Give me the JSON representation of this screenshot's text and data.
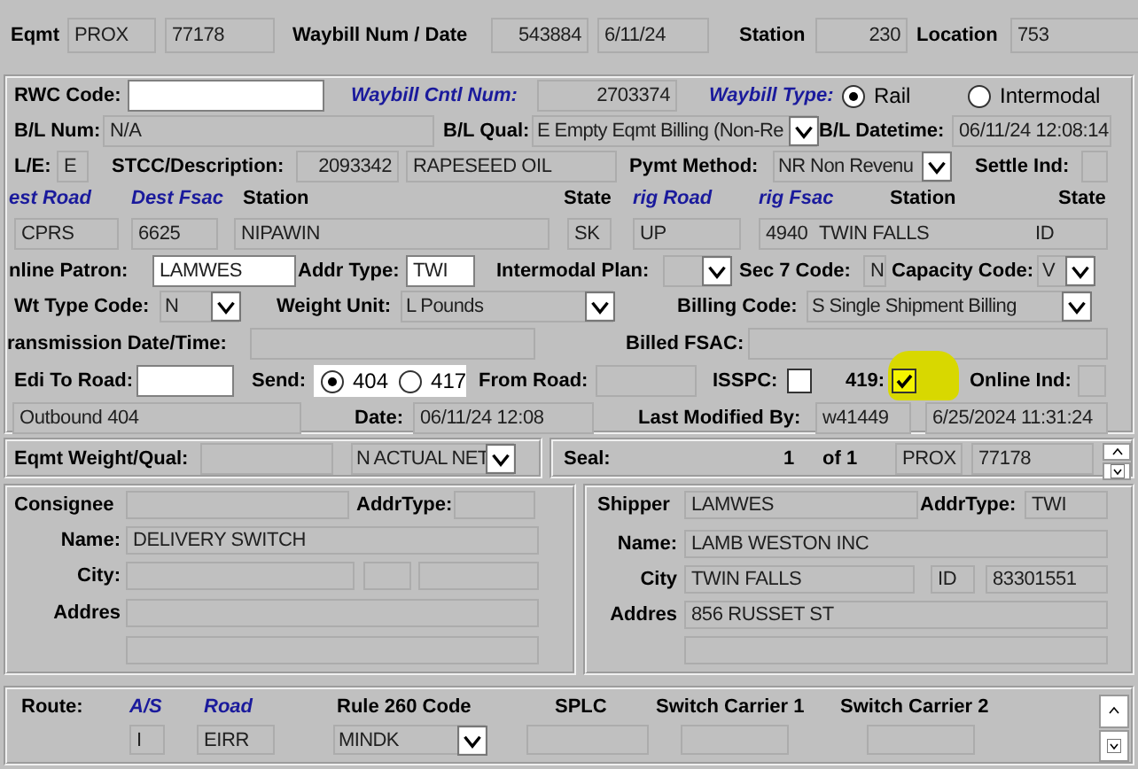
{
  "header": [
    [
      {
        "kind": "label",
        "text": "Eqmt"
      },
      {
        "kind": "field",
        "value": "PROX"
      },
      {
        "kind": "field",
        "value": "77178"
      },
      {
        "kind": "label",
        "text": "Waybill Num / Date"
      },
      {
        "kind": "field",
        "value": "543884"
      },
      {
        "kind": "field",
        "value": "6/11/24"
      },
      {
        "kind": "label",
        "text": "Station"
      },
      {
        "kind": "field",
        "value": "230"
      },
      {
        "kind": "label",
        "text": "Location"
      },
      {
        "kind": "field",
        "value": "753"
      }
    ]
  ],
  "waybill_panel": [
    [
      {
        "kind": "label",
        "text": "RWC Code:"
      },
      {
        "kind": "input"
      },
      {
        "kind": "em_label",
        "text": "Waybill Cntl Num:"
      },
      {
        "kind": "field",
        "value": "2703374"
      },
      {
        "kind": "em_label",
        "text": "Waybill Type:"
      },
      {
        "kind": "radio",
        "label": "Rail",
        "selected": true
      },
      {
        "kind": "radio",
        "label": "Intermodal",
        "selected": false
      }
    ],
    [
      {
        "kind": "label",
        "text": "B/L Num:"
      },
      {
        "kind": "field",
        "value": "N/A"
      },
      {
        "kind": "label",
        "text": "B/L Qual:"
      },
      {
        "kind": "select",
        "value": "E Empty Eqmt Billing (Non-Re"
      },
      {
        "kind": "label",
        "text": "B/L Datetime:"
      },
      {
        "kind": "field",
        "value": "06/11/24 12:08:14"
      }
    ],
    [
      {
        "kind": "label",
        "text": "L/E:"
      },
      {
        "kind": "field",
        "value": "E"
      },
      {
        "kind": "label",
        "text": "STCC/Description:"
      },
      {
        "kind": "field",
        "value": "2093342"
      },
      {
        "kind": "field",
        "value": "RAPESEED OIL"
      },
      {
        "kind": "label",
        "text": "Pymt Method:"
      },
      {
        "kind": "select",
        "value": "NR Non Revenu"
      },
      {
        "kind": "label",
        "text": "Settle Ind:"
      },
      {
        "kind": "field"
      }
    ],
    [
      {
        "kind": "em_label",
        "text": "est Road"
      },
      {
        "kind": "em_label",
        "text": "Dest Fsac"
      },
      {
        "kind": "label",
        "text": "Station"
      },
      {
        "kind": "label",
        "text": "State"
      },
      {
        "kind": "em_label",
        "text": "rig Road"
      },
      {
        "kind": "em_label",
        "text": "rig Fsac"
      },
      {
        "kind": "label",
        "text": "Station"
      },
      {
        "kind": "label",
        "text": "State"
      }
    ],
    [
      {
        "kind": "field",
        "value": "CPRS"
      },
      {
        "kind": "field",
        "value": "6625"
      },
      {
        "kind": "field",
        "value": "NIPAWIN"
      },
      {
        "kind": "field",
        "value": "SK"
      },
      {
        "kind": "field",
        "value": "UP"
      },
      {
        "kind": "multi_field",
        "values": [
          "4940",
          "TWIN FALLS",
          "ID"
        ]
      }
    ],
    [
      {
        "kind": "label",
        "text": "nline Patron:"
      },
      {
        "kind": "input",
        "value": "LAMWES"
      },
      {
        "kind": "label",
        "text": "Addr Type:"
      },
      {
        "kind": "input",
        "value": "TWI"
      },
      {
        "kind": "label",
        "text": "Intermodal Plan:"
      },
      {
        "kind": "select"
      },
      {
        "kind": "label",
        "text": "Sec 7 Code:"
      },
      {
        "kind": "field",
        "value": "N"
      },
      {
        "kind": "label",
        "text": "Capacity Code:"
      },
      {
        "kind": "select",
        "value": "V"
      }
    ],
    [
      {
        "kind": "label",
        "text": "Wt Type Code:"
      },
      {
        "kind": "select",
        "value": "N"
      },
      {
        "kind": "label",
        "text": "Weight Unit:"
      },
      {
        "kind": "select",
        "value": "L Pounds"
      },
      {
        "kind": "label",
        "text": "Billing Code:"
      },
      {
        "kind": "select",
        "value": "S Single Shipment Billing"
      }
    ],
    [
      {
        "kind": "label",
        "text": "ransmission Date/Time:"
      },
      {
        "kind": "field"
      },
      {
        "kind": "label",
        "text": "Billed FSAC:"
      },
      {
        "kind": "field"
      }
    ],
    [
      {
        "kind": "label",
        "text": "Edi To Road:"
      },
      {
        "kind": "input"
      },
      {
        "kind": "label",
        "text": "Send:"
      },
      {
        "kind": "radio_group",
        "options": [
          {
            "label": "404",
            "selected": true
          },
          {
            "label": "417",
            "selected": false
          }
        ]
      },
      {
        "kind": "label",
        "text": "From Road:"
      },
      {
        "kind": "field"
      },
      {
        "kind": "label",
        "text": "ISSPC:"
      },
      {
        "kind": "checkbox",
        "checked": false
      },
      {
        "kind": "label",
        "text": "419:"
      },
      {
        "kind": "checkbox",
        "checked": true,
        "highlighted": true
      },
      {
        "kind": "label",
        "text": "Online Ind:"
      },
      {
        "kind": "field"
      }
    ],
    [
      {
        "kind": "field",
        "value": "Outbound 404"
      },
      {
        "kind": "label",
        "text": "Date:"
      },
      {
        "kind": "field",
        "value": "06/11/24 12:08"
      },
      {
        "kind": "label",
        "text": "Last Modified By:"
      },
      {
        "kind": "field",
        "value": "w41449"
      },
      {
        "kind": "field",
        "value": "6/25/2024 11:31:24"
      }
    ]
  ],
  "weight_panel": [
    [
      {
        "kind": "label",
        "text": "Eqmt Weight/Qual:"
      },
      {
        "kind": "field"
      },
      {
        "kind": "select",
        "value": "N ACTUAL NET"
      }
    ]
  ],
  "seal_panel": [
    [
      {
        "kind": "label",
        "text": "Seal:"
      },
      {
        "kind": "label",
        "text": "1"
      },
      {
        "kind": "label",
        "text": "of 1"
      },
      {
        "kind": "field",
        "value": "PROX"
      },
      {
        "kind": "field",
        "value": "77178"
      },
      {
        "kind": "spinner"
      }
    ]
  ],
  "consignee_panel": [
    [
      {
        "kind": "label",
        "text": "Consignee"
      },
      {
        "kind": "field"
      },
      {
        "kind": "label",
        "text": "AddrType:"
      },
      {
        "kind": "field"
      }
    ],
    [
      {
        "kind": "label",
        "text": "Name:"
      },
      {
        "kind": "field",
        "value": "DELIVERY SWITCH"
      }
    ],
    [
      {
        "kind": "label",
        "text": "City:"
      },
      {
        "kind": "field"
      },
      {
        "kind": "field"
      },
      {
        "kind": "field"
      }
    ],
    [
      {
        "kind": "label",
        "text": "Addres"
      },
      {
        "kind": "field"
      }
    ],
    [
      {
        "kind": "field"
      }
    ]
  ],
  "shipper_panel": [
    [
      {
        "kind": "label",
        "text": "Shipper"
      },
      {
        "kind": "field",
        "value": "LAMWES"
      },
      {
        "kind": "label",
        "text": "AddrType:"
      },
      {
        "kind": "field",
        "value": "TWI"
      }
    ],
    [
      {
        "kind": "label",
        "text": "Name:"
      },
      {
        "kind": "field",
        "value": "LAMB WESTON INC"
      }
    ],
    [
      {
        "kind": "label",
        "text": "City"
      },
      {
        "kind": "field",
        "value": "TWIN FALLS"
      },
      {
        "kind": "field",
        "value": "ID"
      },
      {
        "kind": "field",
        "value": "83301551"
      }
    ],
    [
      {
        "kind": "label",
        "text": "Addres"
      },
      {
        "kind": "field",
        "value": "856 RUSSET ST"
      }
    ],
    [
      {
        "kind": "field"
      }
    ]
  ],
  "route_panel": [
    [
      {
        "kind": "label",
        "text": "Route:"
      },
      {
        "kind": "em_label",
        "text": "A/S"
      },
      {
        "kind": "em_label",
        "text": "Road"
      },
      {
        "kind": "label",
        "text": "Rule 260 Code"
      },
      {
        "kind": "label",
        "text": "SPLC"
      },
      {
        "kind": "label",
        "text": "Switch Carrier 1"
      },
      {
        "kind": "label",
        "text": "Switch Carrier 2"
      },
      {
        "kind": "spinner"
      }
    ],
    [
      {
        "kind": "field",
        "value": "I"
      },
      {
        "kind": "field",
        "value": "EIRR"
      },
      {
        "kind": "select",
        "value": "MINDK"
      },
      {
        "kind": "field"
      },
      {
        "kind": "field"
      },
      {
        "kind": "field"
      }
    ]
  ]
}
